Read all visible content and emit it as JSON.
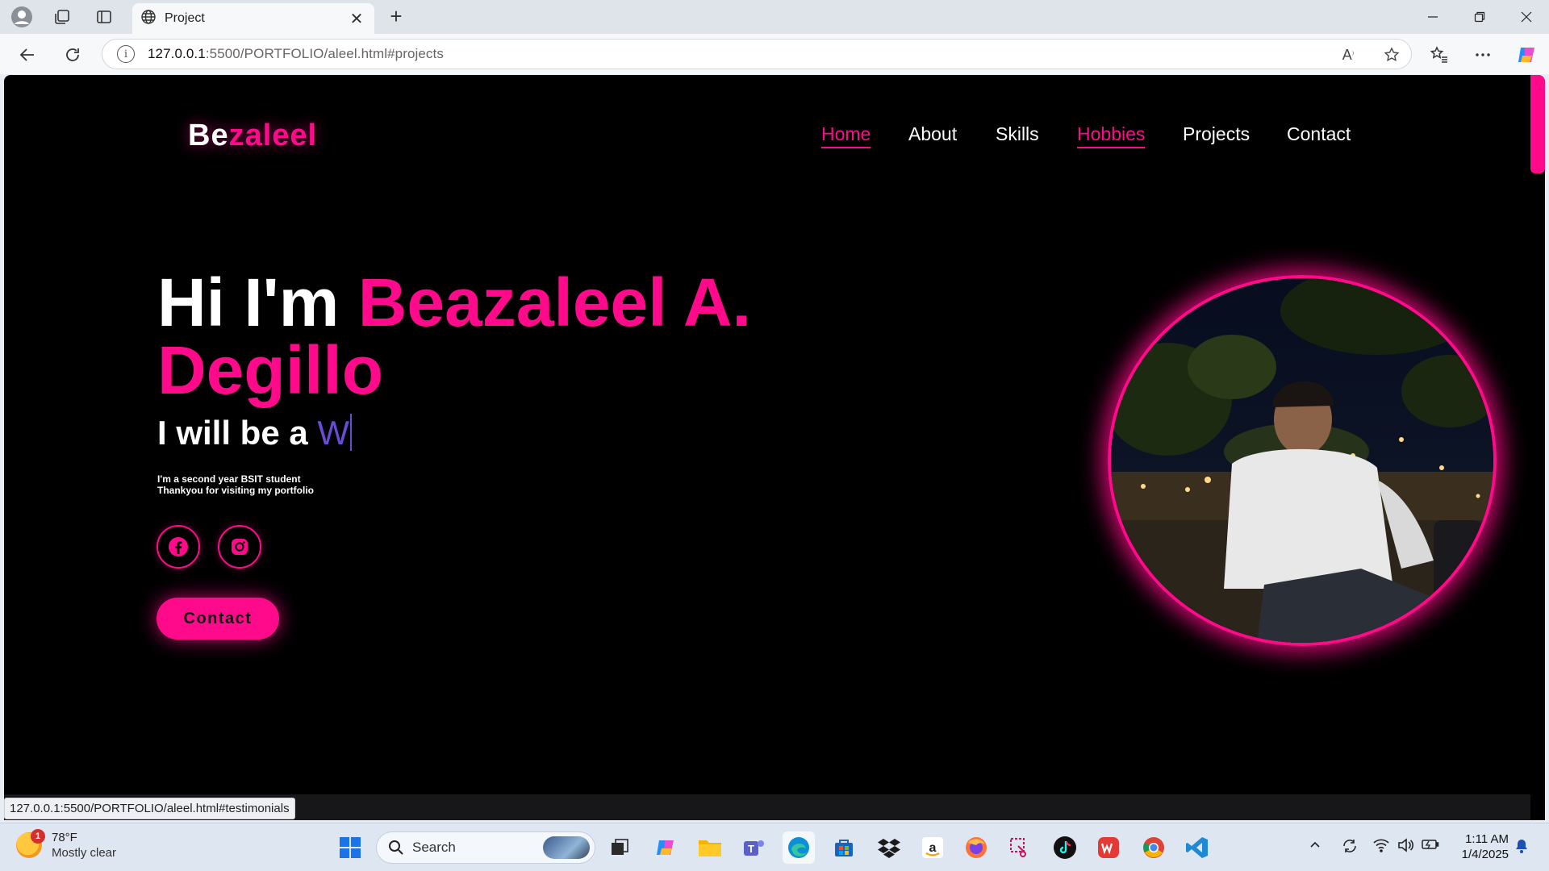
{
  "browser": {
    "tab_title": "Project",
    "url_host": "127.0.0.1",
    "url_rest": ":5500/PORTFOLIO/aleel.html#projects",
    "status_url": "127.0.0.1:5500/PORTFOLIO/aleel.html#testimonials"
  },
  "site": {
    "logo_white": "Be",
    "logo_pink": "zaleel",
    "nav": [
      "Home",
      "About",
      "Skills",
      "Hobbies",
      "Projects",
      "Contact"
    ],
    "hero_prefix": "Hi I'm ",
    "hero_name": "Beazaleel A. Degillo",
    "typing_prefix": "I will be a ",
    "typing_text": "W",
    "bio_line1": "I'm a second year BSIT student",
    "bio_line2": "Thankyou for visiting my portfolio",
    "contact_label": "Contact",
    "accent_color": "#ff0a8a"
  },
  "taskbar": {
    "weather_temp": "78°F",
    "weather_cond": "Mostly clear",
    "weather_badge": "1",
    "search_label": "Search",
    "time": "1:11 AM",
    "date": "1/4/2025"
  }
}
